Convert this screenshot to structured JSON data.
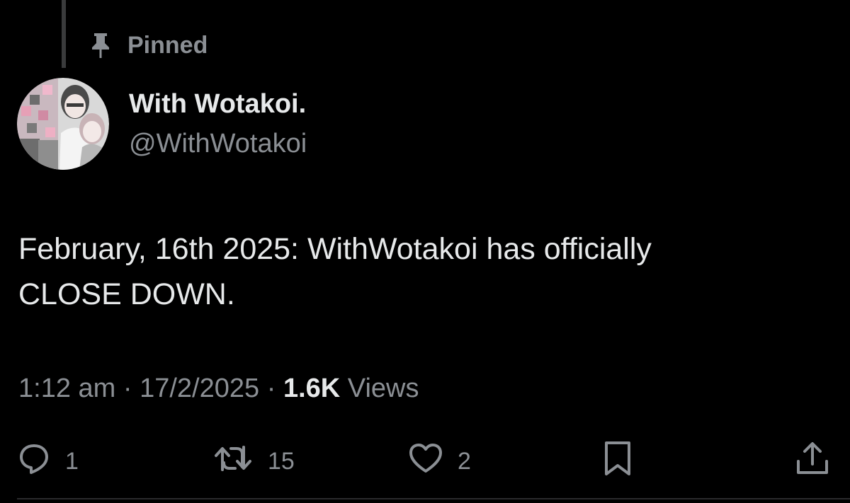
{
  "pinned": {
    "label": "Pinned",
    "icon": "pin-icon"
  },
  "author": {
    "display_name": "With Wotakoi.",
    "handle": "@WithWotakoi",
    "avatar_icon": "avatar-image"
  },
  "tweet": {
    "text_line1": "February, 16th 2025: WithWotakoi has officially",
    "text_line2": "CLOSE DOWN."
  },
  "meta": {
    "time": "1:12 am",
    "sep1": "·",
    "date": "17/2/2025",
    "sep2": "·",
    "views_count": "1.6K",
    "views_label": "Views"
  },
  "actions": {
    "reply": {
      "icon": "reply-icon",
      "count": "1"
    },
    "retweet": {
      "icon": "retweet-icon",
      "count": "15"
    },
    "like": {
      "icon": "heart-icon",
      "count": "2"
    },
    "bookmark": {
      "icon": "bookmark-icon"
    },
    "share": {
      "icon": "share-icon"
    }
  },
  "colors": {
    "background": "#000000",
    "primary_text": "#e7e9ea",
    "secondary_text": "#8b8f94"
  }
}
